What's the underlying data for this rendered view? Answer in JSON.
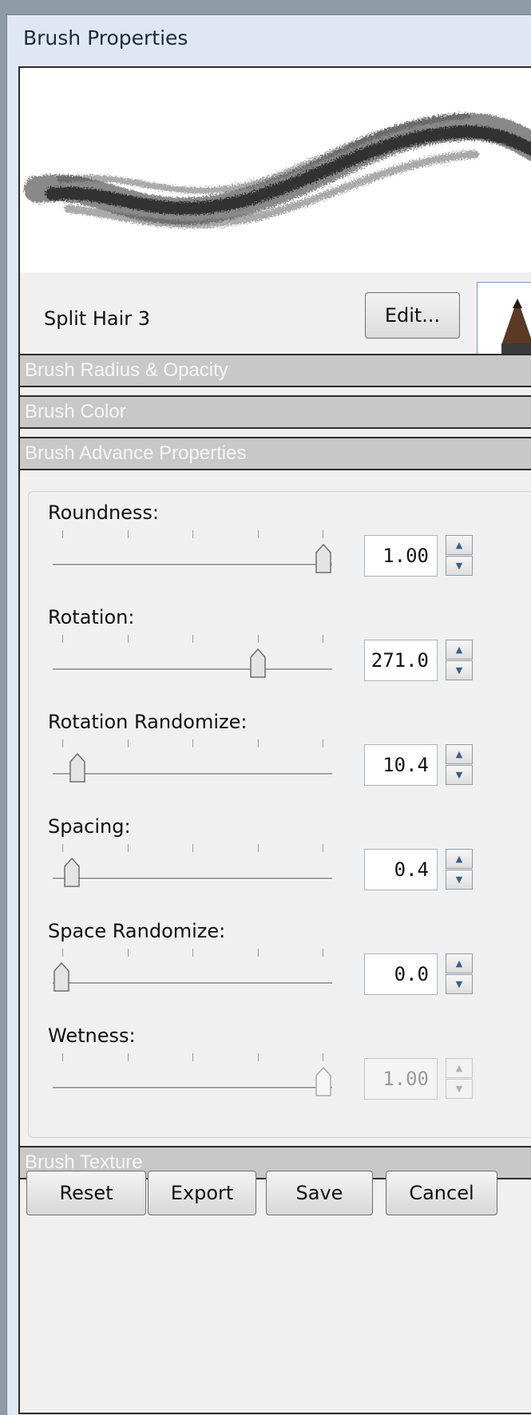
{
  "window": {
    "title": "Brush Properties"
  },
  "brush": {
    "name": "Split Hair 3",
    "edit_label": "Edit..."
  },
  "sections": {
    "radius_opacity": "Brush Radius & Opacity",
    "color": "Brush Color",
    "advance": "Brush Advance Properties",
    "texture": "Brush Texture"
  },
  "controls": [
    {
      "label": "Roundness:",
      "value": "1.00",
      "fraction": 1.0,
      "enabled": true
    },
    {
      "label": "Rotation:",
      "value": "271.0",
      "fraction": 0.75,
      "enabled": true
    },
    {
      "label": "Rotation Randomize:",
      "value": "10.4",
      "fraction": 0.06,
      "enabled": true
    },
    {
      "label": "Spacing:",
      "value": "0.4",
      "fraction": 0.04,
      "enabled": true
    },
    {
      "label": "Space Randomize:",
      "value": "0.0",
      "fraction": 0.0,
      "enabled": true
    },
    {
      "label": "Wetness:",
      "value": "1.00",
      "fraction": 1.0,
      "enabled": false
    }
  ],
  "buttons": {
    "reset": "Reset",
    "export": "Export",
    "save": "Save",
    "cancel": "Cancel"
  }
}
